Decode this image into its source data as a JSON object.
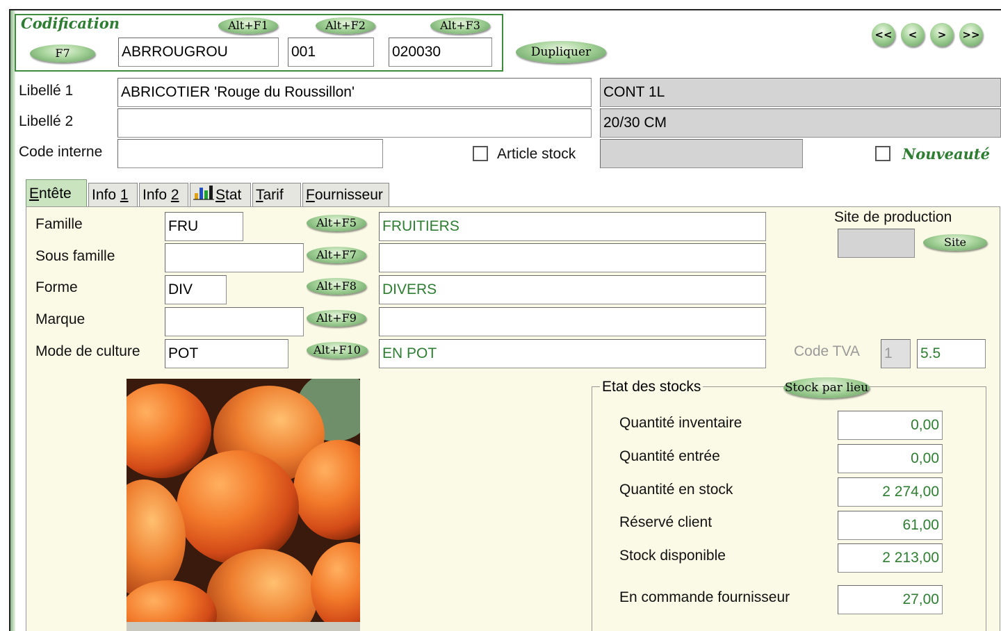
{
  "codification": {
    "title": "Codification",
    "f7_label": "F7",
    "altf1_label": "Alt+F1",
    "altf2_label": "Alt+F2",
    "altf3_label": "Alt+F3",
    "code1": "ABRROUGROU",
    "code2": "001",
    "code3": "020030",
    "duplicate_label": "Dupliquer"
  },
  "nav": {
    "first": "<<",
    "prev": "<",
    "next": ">",
    "last": ">>"
  },
  "header": {
    "libelle1_label": "Libellé 1",
    "libelle1_value": "ABRICOTIER 'Rouge du Roussillon'",
    "libelle2_label": "Libellé 2",
    "libelle2_value": "",
    "code_interne_label": "Code interne",
    "code_interne_value": "",
    "conditionnement": "CONT 1L",
    "taille": "20/30 CM",
    "extra_value": "",
    "article_stock_label": "Article stock",
    "nouveaute_label": "Nouveauté"
  },
  "tabs": [
    {
      "label_u": "E",
      "label_rest": "ntête"
    },
    {
      "label_pre": "Info ",
      "label_u": "1"
    },
    {
      "label_pre": "Info ",
      "label_u": "2"
    },
    {
      "label_u": "S",
      "label_rest": "tat"
    },
    {
      "label_u": "T",
      "label_rest": "arif"
    },
    {
      "label_u": "F",
      "label_rest": "ournisseur"
    }
  ],
  "entete": {
    "famille_label": "Famille",
    "famille_code": "FRU",
    "famille_btn": "Alt+F5",
    "famille_desc": "FRUITIERS",
    "sousfamille_label": "Sous famille",
    "sousfamille_code": "",
    "sousfamille_btn": "Alt+F7",
    "sousfamille_desc": "",
    "forme_label": "Forme",
    "forme_code": "DIV",
    "forme_btn": "Alt+F8",
    "forme_desc": "DIVERS",
    "marque_label": "Marque",
    "marque_code": "",
    "marque_btn": "Alt+F9",
    "marque_desc": "",
    "culture_label": "Mode de culture",
    "culture_code": "POT",
    "culture_btn": "Alt+F10",
    "culture_desc": "EN POT",
    "site_label": "Site de production",
    "site_value": "",
    "site_btn": "Site",
    "tva_label": "Code TVA",
    "tva_code": "1",
    "tva_rate": "5.5"
  },
  "stocks": {
    "title": "Etat des stocks",
    "stock_par_lieu_btn": "Stock par lieu",
    "rows": [
      {
        "label": "Quantité inventaire",
        "value": "0,00"
      },
      {
        "label": "Quantité entrée",
        "value": "0,00"
      },
      {
        "label": "Quantité en stock",
        "value": "2 274,00"
      },
      {
        "label": "Réservé client",
        "value": "61,00"
      },
      {
        "label": "Stock disponible",
        "value": "2 213,00"
      },
      {
        "label": "En commande fournisseur",
        "value": "27,00"
      }
    ]
  },
  "colors": {
    "accent_green": "#3d8c3d",
    "value_green": "#2e7d32",
    "panel_bg": "#fafae6",
    "button_green": "#a6d39a"
  }
}
